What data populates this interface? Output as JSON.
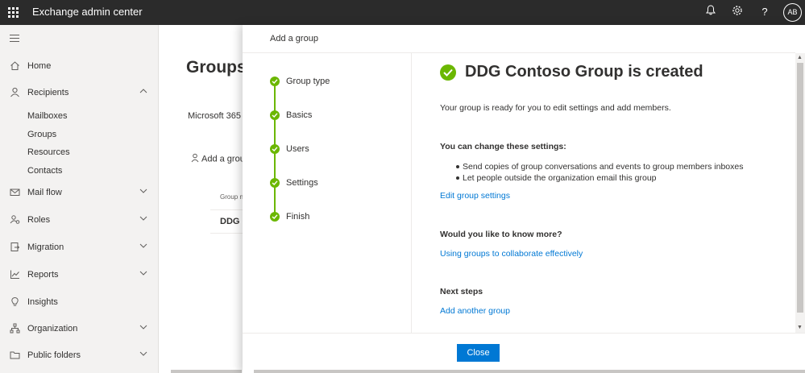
{
  "topbar": {
    "title": "Exchange admin center",
    "avatar_initials": "AB",
    "help_glyph": "?"
  },
  "sidebar": {
    "items": [
      {
        "label": "Home",
        "icon": "home-icon"
      },
      {
        "label": "Recipients",
        "icon": "person-icon",
        "expanded": true
      },
      {
        "label": "Mail flow",
        "icon": "mail-icon"
      },
      {
        "label": "Roles",
        "icon": "roles-icon"
      },
      {
        "label": "Migration",
        "icon": "migration-icon"
      },
      {
        "label": "Reports",
        "icon": "chart-icon"
      },
      {
        "label": "Insights",
        "icon": "lightbulb-icon"
      },
      {
        "label": "Organization",
        "icon": "organization-icon"
      },
      {
        "label": "Public folders",
        "icon": "folder-icon"
      }
    ],
    "recipients_sub": [
      "Mailboxes",
      "Groups",
      "Resources",
      "Contacts"
    ]
  },
  "background": {
    "page_title": "Groups",
    "tab": "Microsoft 365",
    "add_button": "Add a group",
    "column_header": "Group n",
    "row_cell": "DDG C"
  },
  "panel": {
    "title": "Add a group",
    "steps": [
      "Group type",
      "Basics",
      "Users",
      "Settings",
      "Finish"
    ],
    "success_title": "DDG Contoso Group is created",
    "ready_text": "Your group is ready for you to edit settings and add members.",
    "change_heading": "You can change these settings:",
    "bullets": [
      "Send copies of group conversations and events to group members inboxes",
      "Let people outside the organization email this group"
    ],
    "edit_link": "Edit group settings",
    "know_more_heading": "Would you like to know more?",
    "know_more_link": "Using groups to collaborate effectively",
    "next_steps_heading": "Next steps",
    "next_steps_link": "Add another group",
    "close_label": "Close"
  },
  "colors": {
    "topbar": "#2b2b2b",
    "accent": "#0078d4",
    "success": "#6bb700"
  }
}
